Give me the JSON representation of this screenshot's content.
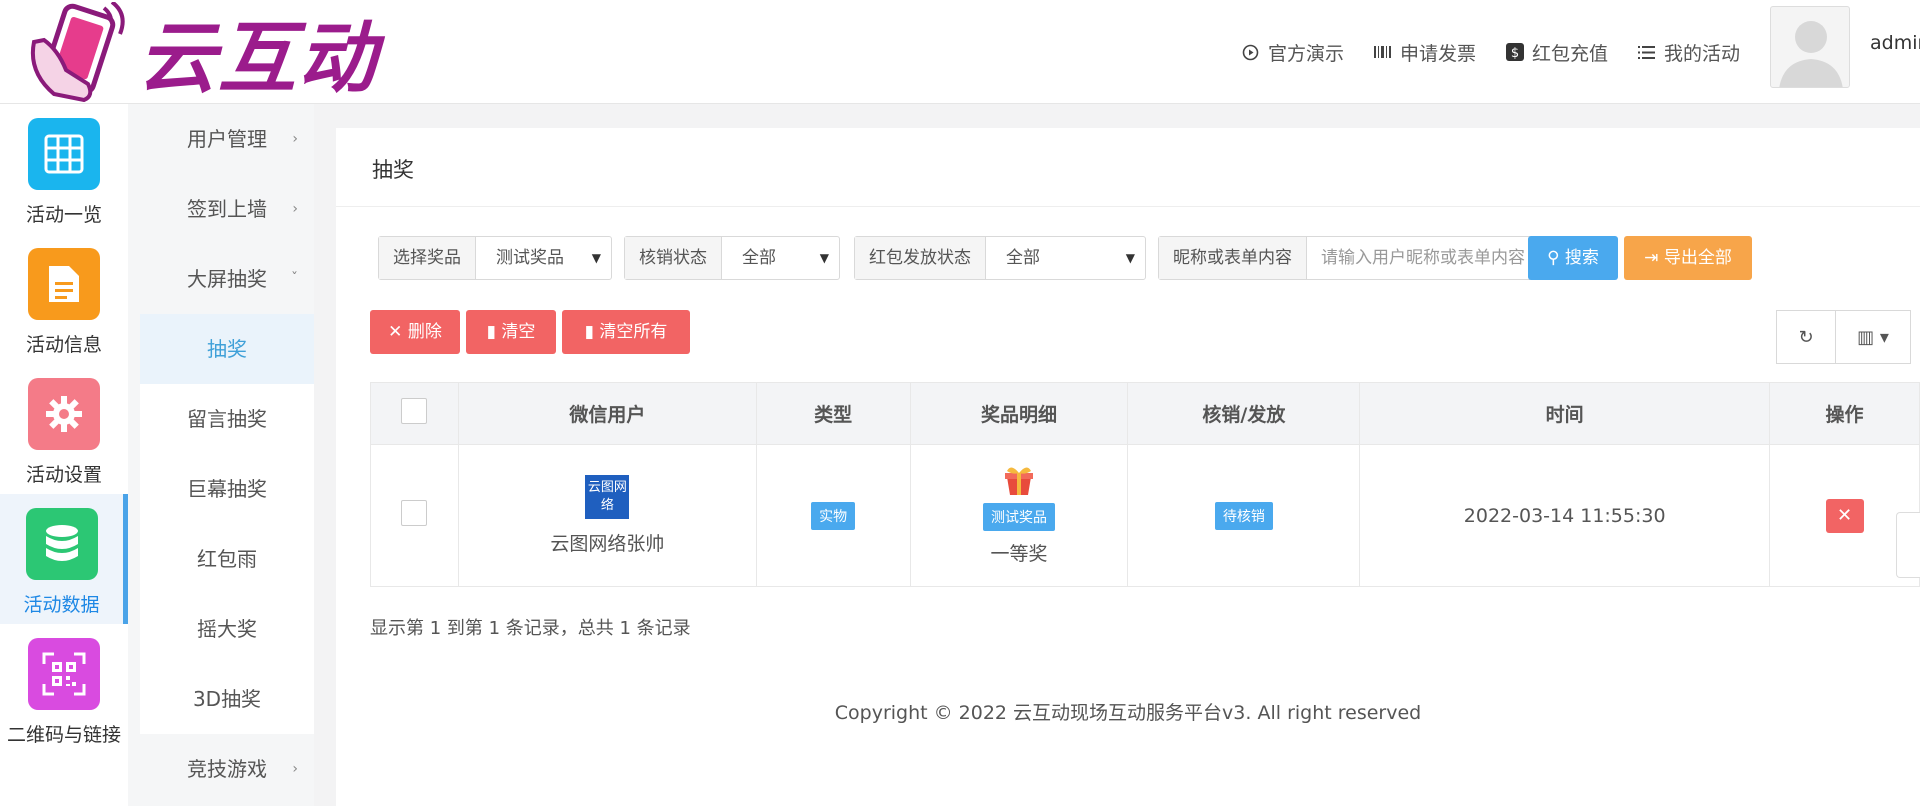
{
  "brand": {
    "name": "云互动"
  },
  "topnav": [
    {
      "label": "官方演示",
      "icon": "play-circle-icon"
    },
    {
      "label": "申请发票",
      "icon": "barcode-icon"
    },
    {
      "label": "红包充值",
      "icon": "dollar-icon"
    },
    {
      "label": "我的活动",
      "icon": "list-icon"
    }
  ],
  "user": {
    "name": "admin"
  },
  "rail": [
    {
      "label": "活动一览",
      "icon": "grid-icon",
      "color": "#1ab5ee"
    },
    {
      "label": "活动信息",
      "icon": "document-icon",
      "color": "#f89a1c"
    },
    {
      "label": "活动设置",
      "icon": "gear-icon",
      "color": "#f47b88"
    },
    {
      "label": "活动数据",
      "icon": "database-icon",
      "color": "#2cc774",
      "active": true
    },
    {
      "label": "二维码与链接",
      "icon": "qrcode-icon",
      "color": "#d94be0"
    }
  ],
  "submenu": [
    {
      "label": "用户管理"
    },
    {
      "label": "签到上墙"
    },
    {
      "label": "大屏抽奖"
    },
    {
      "label": "抽奖"
    },
    {
      "label": "留言抽奖"
    },
    {
      "label": "巨幕抽奖"
    },
    {
      "label": "红包雨"
    },
    {
      "label": "摇大奖"
    },
    {
      "label": "3D抽奖"
    },
    {
      "label": "竞技游戏"
    }
  ],
  "page": {
    "title": "抽奖"
  },
  "filters": {
    "prize_label": "选择奖品",
    "prize_value": "测试奖品",
    "verify_label": "核销状态",
    "verify_value": "全部",
    "redpacket_label": "红包发放状态",
    "redpacket_value": "全部",
    "search_label": "昵称或表单内容",
    "search_placeholder": "请输入用户昵称或表单内容",
    "search_button": "搜索",
    "export_button": "导出全部"
  },
  "actions": {
    "delete": "删除",
    "clear": "清空",
    "clear_all": "清空所有"
  },
  "table": {
    "headers": [
      "微信用户",
      "类型",
      "奖品明细",
      "核销/发放",
      "时间",
      "操作"
    ],
    "rows": [
      {
        "user_name": "云图网络张帅",
        "avatar_text": "云图网络",
        "type": "实物",
        "prize_badge": "测试奖品",
        "prize_name": "一等奖",
        "status": "待核销",
        "time": "2022-03-14 11:55:30"
      }
    ]
  },
  "records": "显示第 1 到第 1 条记录，总共 1 条记录",
  "copyright": "Copyright © 2022 云互动现场互动服务平台v3. All right reserved"
}
